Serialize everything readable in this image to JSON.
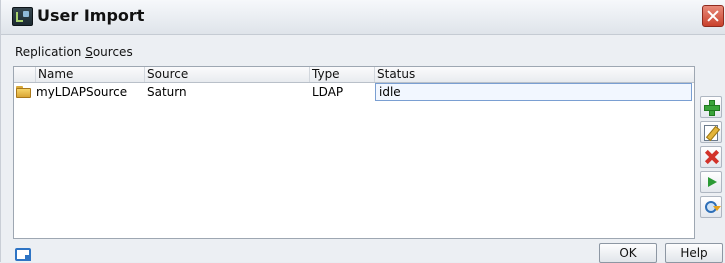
{
  "window": {
    "title": "User Import",
    "accent_color": "#c9412c"
  },
  "section": {
    "label_prefix": "Replication ",
    "label_mnemonic": "S",
    "label_suffix": "ources"
  },
  "table": {
    "columns": [
      "Name",
      "Source",
      "Type",
      "Status"
    ],
    "rows": [
      {
        "icon": "folder-icon",
        "name": "myLDAPSource",
        "source": "Saturn",
        "type": "LDAP",
        "status": "idle"
      }
    ]
  },
  "side_toolbar": {
    "icons": [
      "add-icon",
      "edit-icon",
      "delete-icon",
      "run-icon",
      "sync-icon"
    ]
  },
  "footer": {
    "ok_label": "OK",
    "help_label": "Help",
    "left_icon": "window-icon"
  }
}
